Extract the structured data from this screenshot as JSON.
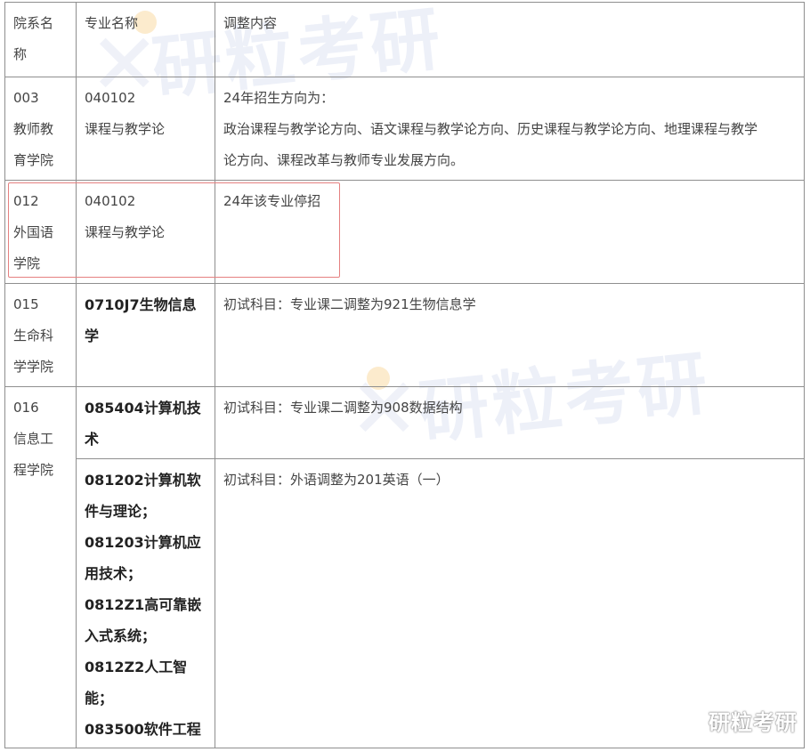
{
  "header": {
    "col1": [
      "院系名",
      "称"
    ],
    "col2": "专业名称",
    "col3": "调整内容"
  },
  "rows": [
    {
      "dept": [
        "003",
        "教师教",
        "育学院"
      ],
      "major": [
        "040102",
        "课程与教学论"
      ],
      "content": [
        "24年招生方向为：",
        "政治课程与教学论方向、语文课程与教学论方向、历史课程与教学论方向、地理课程与教学",
        "论方向、课程改革与教师专业发展方向。"
      ]
    },
    {
      "dept": [
        "012",
        "外国语",
        "学院"
      ],
      "major": [
        "040102",
        "课程与教学论"
      ],
      "content": [
        "24年该专业停招"
      ]
    },
    {
      "dept": [
        "015",
        "生命科",
        "学学院"
      ],
      "major": [
        "0710J7生物信息",
        "学"
      ],
      "content": [
        "初试科目：专业课二调整为921生物信息学"
      ]
    },
    {
      "dept": [
        "016",
        "信息工",
        "程学院"
      ],
      "major": [
        "085404计算机技",
        "术"
      ],
      "content": [
        "初试科目：专业课二调整为908数据结构"
      ]
    },
    {
      "major": [
        "081202计算机软",
        "件与理论；",
        "081203计算机应",
        "用技术；",
        "0812Z1高可靠嵌",
        "入式系统；",
        "0812Z2人工智",
        "能；",
        "083500软件工程"
      ],
      "content": [
        "初试科目：外语调整为201英语（一）"
      ]
    }
  ],
  "watermark": {
    "text": "研粒考研",
    "corner_text": "研粒考研"
  }
}
